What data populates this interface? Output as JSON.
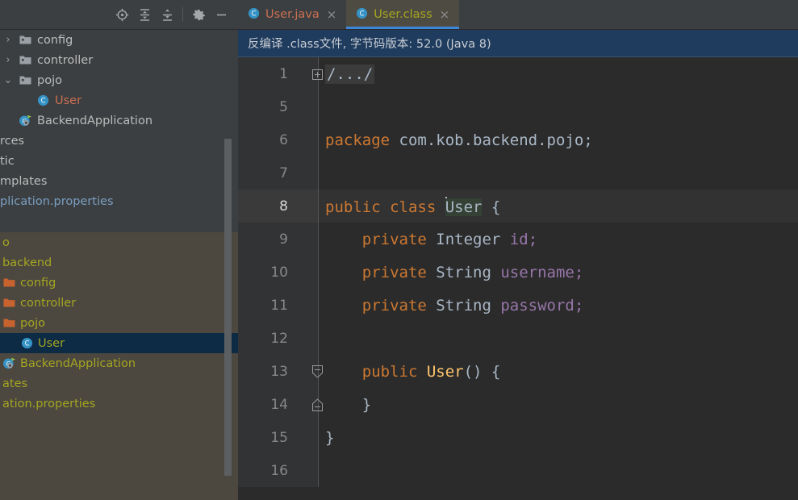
{
  "project_panel": {
    "toolbar": {
      "buttons": [
        {
          "name": "locate-target-icon",
          "title": "Select Opened File"
        },
        {
          "name": "expand-all-icon",
          "title": "Expand All"
        },
        {
          "name": "collapse-all-icon",
          "title": "Collapse All"
        },
        {
          "name": "settings-gear-icon",
          "title": "Settings"
        },
        {
          "name": "minimize-icon",
          "title": "Hide"
        }
      ]
    },
    "tree": [
      {
        "label": "config",
        "arrow": "›",
        "icon": "package-folder-icon",
        "indent": 0,
        "color": "#bbbbbb",
        "clipped": false
      },
      {
        "label": "controller",
        "arrow": "›",
        "icon": "package-folder-icon",
        "indent": 0,
        "color": "#bbbbbb",
        "clipped": false
      },
      {
        "label": "pojo",
        "arrow": "⌄",
        "icon": "package-folder-icon",
        "indent": 0,
        "color": "#bbbbbb",
        "clipped": false
      },
      {
        "label": "User",
        "arrow": "",
        "icon": "java-class-icon",
        "indent": 1,
        "color": "#cc6f52",
        "clipped": false
      },
      {
        "label": "BackendApplication",
        "arrow": "",
        "icon": "spring-boot-run-icon",
        "indent": 0,
        "color": "#bbbbbb",
        "clipped": false
      },
      {
        "label": "rces",
        "arrow": "",
        "icon": "",
        "indent": 0,
        "color": "#bbbbbb",
        "clipped": true
      },
      {
        "label": "tic",
        "arrow": "",
        "icon": "",
        "indent": 0,
        "color": "#bbbbbb",
        "clipped": true
      },
      {
        "label": "mplates",
        "arrow": "",
        "icon": "",
        "indent": 0,
        "color": "#bbbbbb",
        "clipped": true
      },
      {
        "label": "plication.properties",
        "arrow": "",
        "icon": "",
        "indent": 0,
        "color": "#7a9ec2",
        "clipped": true
      }
    ]
  },
  "search_popup": {
    "rows": [
      {
        "label": "o",
        "icon": "",
        "indent": 0,
        "selected": false
      },
      {
        "label": "backend",
        "icon": "",
        "indent": 0,
        "selected": false
      },
      {
        "label": "config",
        "icon": "folder-icon",
        "indent": 0,
        "selected": false
      },
      {
        "label": "controller",
        "icon": "folder-icon",
        "indent": 0,
        "selected": false
      },
      {
        "label": "pojo",
        "icon": "folder-icon",
        "indent": 0,
        "selected": false
      },
      {
        "label": "User",
        "icon": "java-class-icon",
        "indent": 1,
        "selected": true
      },
      {
        "label": "BackendApplication",
        "icon": "spring-boot-run-icon",
        "indent": 0,
        "selected": false
      },
      {
        "label": "ates",
        "icon": "",
        "indent": 0,
        "selected": false
      },
      {
        "label": "ation.properties",
        "icon": "",
        "indent": 0,
        "selected": false
      }
    ]
  },
  "editor": {
    "tabs": [
      {
        "label": "User.java",
        "icon": "java-class-icon",
        "active": false,
        "style": "java",
        "close": "×"
      },
      {
        "label": "User.class",
        "icon": "java-class-icon",
        "active": true,
        "style": "cls",
        "close": "×"
      }
    ],
    "notification": "反编译 .class文件, 字节码版本: 52.0 (Java 8)",
    "lines": [
      {
        "num": "1",
        "fold": "plus",
        "current": false,
        "type": "folded",
        "text": "/.../"
      },
      {
        "num": "5",
        "fold": "",
        "current": false,
        "type": "blank",
        "text": ""
      },
      {
        "num": "6",
        "fold": "",
        "current": false,
        "type": "package",
        "indent": 0,
        "tokens": [
          {
            "t": "package",
            "c": "kw"
          },
          {
            "t": " com.kob.backend.pojo;",
            "c": "type"
          }
        ]
      },
      {
        "num": "7",
        "fold": "",
        "current": false,
        "type": "blank",
        "text": ""
      },
      {
        "num": "8",
        "fold": "",
        "current": true,
        "type": "classdecl",
        "tokens": [
          {
            "t": "public class ",
            "c": "kw"
          },
          {
            "t": "User",
            "c": "sel-ident"
          },
          {
            "t": " {",
            "c": "punc"
          }
        ]
      },
      {
        "num": "9",
        "fold": "",
        "current": false,
        "type": "field",
        "tokens": [
          {
            "t": "    ",
            "c": "punc"
          },
          {
            "t": "private ",
            "c": "kw"
          },
          {
            "t": "Integer ",
            "c": "type"
          },
          {
            "t": "id",
            "c": "fld"
          },
          {
            "t": ";",
            "c": "fld"
          }
        ]
      },
      {
        "num": "10",
        "fold": "",
        "current": false,
        "type": "field",
        "tokens": [
          {
            "t": "    ",
            "c": "punc"
          },
          {
            "t": "private ",
            "c": "kw"
          },
          {
            "t": "String ",
            "c": "type"
          },
          {
            "t": "username",
            "c": "fld"
          },
          {
            "t": ";",
            "c": "fld"
          }
        ]
      },
      {
        "num": "11",
        "fold": "",
        "current": false,
        "type": "field",
        "tokens": [
          {
            "t": "    ",
            "c": "punc"
          },
          {
            "t": "private ",
            "c": "kw"
          },
          {
            "t": "String ",
            "c": "type"
          },
          {
            "t": "password",
            "c": "fld"
          },
          {
            "t": ";",
            "c": "fld"
          }
        ]
      },
      {
        "num": "12",
        "fold": "",
        "current": false,
        "type": "blank",
        "text": ""
      },
      {
        "num": "13",
        "fold": "down",
        "current": false,
        "type": "ctor",
        "tokens": [
          {
            "t": "    ",
            "c": "punc"
          },
          {
            "t": "public ",
            "c": "kw"
          },
          {
            "t": "User",
            "c": "mtd"
          },
          {
            "t": "() {",
            "c": "punc"
          }
        ]
      },
      {
        "num": "14",
        "fold": "up",
        "current": false,
        "type": "close",
        "tokens": [
          {
            "t": "    }",
            "c": "punc"
          }
        ]
      },
      {
        "num": "15",
        "fold": "",
        "current": false,
        "type": "close",
        "tokens": [
          {
            "t": "}",
            "c": "punc"
          }
        ]
      },
      {
        "num": "16",
        "fold": "",
        "current": false,
        "type": "blank",
        "text": ""
      }
    ]
  },
  "colors": {
    "panel_bg": "#3c3f41",
    "editor_bg": "#2b2b2b",
    "gutter_bg": "#313335",
    "current_line": "#323232",
    "notification_bg": "#1f3b5e",
    "active_tab_bg": "#4e4b42",
    "tab_underline": "#3d87d8",
    "popup_bg": "#4c4840",
    "popup_selected": "#0d2b45",
    "keyword": "#cc7832",
    "field": "#9876aa",
    "method": "#ffc66d",
    "text": "#a9b7c6",
    "class_modified": "#cc6f52",
    "popup_text": "#a5a520"
  }
}
